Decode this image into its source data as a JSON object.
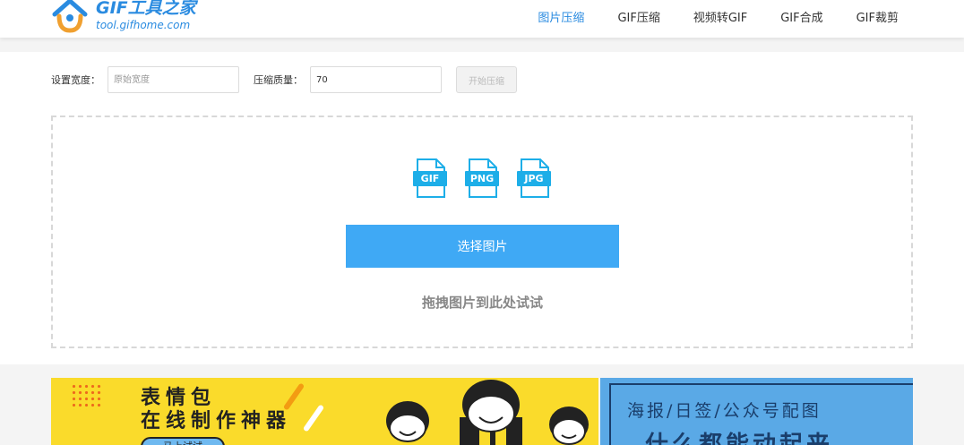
{
  "header": {
    "logo_title": "GIF工具之家",
    "logo_url": "tool.gifhome.com",
    "nav": [
      {
        "label": "图片压缩",
        "active": true
      },
      {
        "label": "GIF压缩",
        "active": false
      },
      {
        "label": "视频转GIF",
        "active": false
      },
      {
        "label": "GIF合成",
        "active": false
      },
      {
        "label": "GIF裁剪",
        "active": false
      }
    ]
  },
  "settings": {
    "width_label": "设置宽度：",
    "width_placeholder": "原始宽度",
    "quality_label": "压缩质量：",
    "quality_value": "70",
    "start_button": "开始压缩"
  },
  "upload": {
    "file_types": [
      "GIF",
      "PNG",
      "JPG"
    ],
    "select_button": "选择图片",
    "drag_hint": "拖拽图片到此处试试"
  },
  "banners": {
    "left": {
      "title_line1": "表情包",
      "title_line2": "在线制作神器",
      "button": "马上试试"
    },
    "right": {
      "line1": "海报/日签/公众号配图",
      "line2": "什么都能动起来"
    }
  },
  "colors": {
    "accent": "#2a8be0",
    "button_blue": "#3fa9f5",
    "file_icon": "#1daee8",
    "banner_yellow": "#fadb2b",
    "banner_blue": "#5aa9e6"
  }
}
